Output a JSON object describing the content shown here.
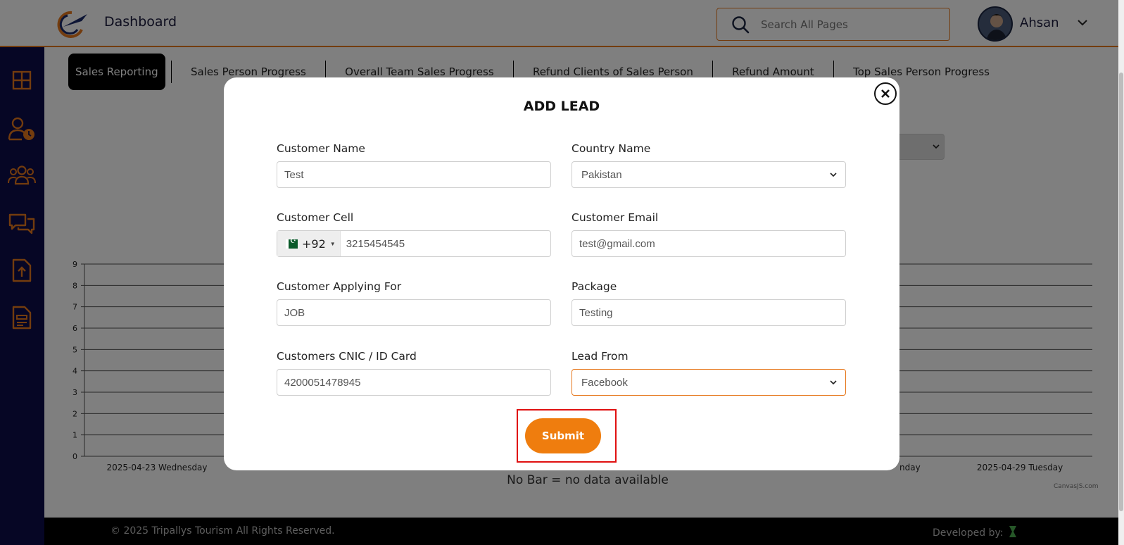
{
  "header": {
    "title": "Dashboard",
    "search_placeholder": "Search All Pages",
    "user_name": "Ahsan"
  },
  "sidebar": {
    "items": [
      "grid-icon",
      "user-clock-icon",
      "users-icon",
      "chat-icon",
      "file-upload-icon",
      "document-icon"
    ]
  },
  "tabs": [
    "Sales Reporting",
    "Sales Person Progress",
    "Overall Team Sales Progress",
    "Refund Clients of Sales Person",
    "Refund Amount",
    "Top Sales Person Progress"
  ],
  "active_tab": "Sales Reporting",
  "chart_data": {
    "type": "bar",
    "ylim": [
      0,
      9
    ],
    "y_ticks": [
      "0",
      "1",
      "2",
      "3",
      "4",
      "5",
      "6",
      "7",
      "8",
      "9"
    ],
    "visible_x_labels": [
      "2025-04-23 Wednesday",
      "2025-04-29 Tuesday"
    ],
    "partial_x_label": "nday",
    "values": [],
    "caption": "No Bar = no data available",
    "credit": "CanvasJS.com"
  },
  "modal": {
    "title": "ADD LEAD",
    "fields": {
      "customer_name": {
        "label": "Customer Name",
        "value": "Test"
      },
      "country_name": {
        "label": "Country Name",
        "value": "Pakistan"
      },
      "customer_cell": {
        "label": "Customer Cell",
        "dial_code": "+92",
        "value": "3215454545"
      },
      "customer_email": {
        "label": "Customer Email",
        "value": "test@gmail.com"
      },
      "applying_for": {
        "label": "Customer Applying For",
        "value": "JOB"
      },
      "package": {
        "label": "Package",
        "value": "Testing"
      },
      "cnic": {
        "label": "Customers CNIC / ID Card",
        "value": "4200051478945"
      },
      "lead_from": {
        "label": "Lead From",
        "value": "Facebook"
      }
    },
    "submit_label": "Submit"
  },
  "footer": {
    "copyright": "© 2025 Tripallys Tourism All Rights Reserved.",
    "developed_by": "Developed by:"
  },
  "colors": {
    "accent": "#ef7d0e",
    "sidebar": "#0d0d4a",
    "highlight_frame": "#e01010"
  }
}
